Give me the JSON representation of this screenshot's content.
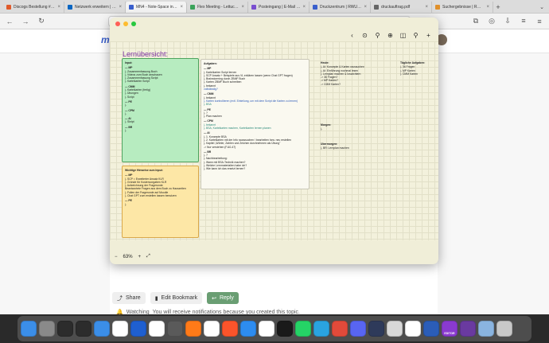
{
  "browser": {
    "tabs": [
      {
        "label": "Discogs Bestellung #76...",
        "color": "#e05a2b",
        "active": false
      },
      {
        "label": "Netzwerk erweitern | Li...",
        "color": "#0a66c2",
        "active": false
      },
      {
        "label": "MN4 - Note-Space in S...",
        "color": "#3a5fcd",
        "active": true
      },
      {
        "label": "Flex Meeting - Lettuce...",
        "color": "#3aa35a",
        "active": false
      },
      {
        "label": "Posteingang | E-Mail | ...",
        "color": "#7a4fd0",
        "active": false
      },
      {
        "label": "Druckzentrum | RWU H...",
        "color": "#3a5fcd",
        "active": false
      },
      {
        "label": "druckauftrag.pdf",
        "color": "#666666",
        "active": false
      },
      {
        "label": "Suchergebnisse | RWU...",
        "color": "#e0902b",
        "active": false
      }
    ],
    "new_tab": "+",
    "tab_overflow": "⌄",
    "nav": {
      "back": "←",
      "forward": "→",
      "reload": "↻",
      "shield": "◈",
      "lock": "🔒",
      "url": "",
      "star": "☆",
      "menu": "≡"
    },
    "extensions": [
      "⧉",
      "◎",
      "⇩",
      "≡"
    ]
  },
  "site": {
    "logo": "m",
    "close_tab": "×"
  },
  "note_app": {
    "toolbar_icons": [
      "‹",
      "⊙",
      "⚲",
      "⊕",
      "◫",
      "⚲",
      "+"
    ],
    "overview_title": "Lernübersicht:",
    "zoom": {
      "minus": "−",
      "value": "63%",
      "plus": "+",
      "fit": "⤢"
    },
    "cards": {
      "input": {
        "heading": "Input:",
        "sections": [
          {
            "title": "— MP",
            "items": [
              "  |- Zusammenfassung Buch",
              "  |- Videos zum Buch anschauen",
              "  |- Zusammenfassung Script",
              "  |- Karteikarten Script"
            ]
          },
          {
            "title": "— CMM",
            "items": [
              "  |- Karteikarten (fertig)",
              "  |- Übungen",
              "  |- Script"
            ]
          },
          {
            "title": "— PE",
            "items": [
              "  |-"
            ]
          },
          {
            "title": "— CPM",
            "items": [
              "  |-"
            ]
          },
          {
            "title": "— AI",
            "items": [
              "  |- Skript"
            ]
          },
          {
            "title": "— BR",
            "items": [
              "  |-"
            ]
          }
        ]
      },
      "hinweise": {
        "heading": "Wichtige Hinweise zum Input:",
        "sections": [
          {
            "title": "— MP",
            "items": [
              "  |- SCP = Erweiterter Ansatz KLR",
              "  |- Gründe für Kostenvorgaben KLR",
              "  |- Aufzeichnung der Fragerunde",
              "       Beantwortete Fragen aus dem Buch zu Hauszeiten",
              "  |- Folien der Fragerunde auf Moodle",
              "  |- Chat GPT zum erstellen lassen benutzen"
            ]
          },
          {
            "title": "— PE",
            "items": [
              "  |-"
            ]
          }
        ]
      },
      "aufgaben": {
        "heading": "Aufgaben:",
        "sections": [
          {
            "title": "— MP",
            "items": [
              "  |- Karteikarten Script lernen",
              "  |- SCP Ansatz + Beispiele aus VL erklären lassen (wenn Chat GPT fragen)",
              "  |- Brainstorming durch ZBMF Buch",
              "  |- Karten ZBMF Buch schreiben",
              "  |- bekannt"
            ],
            "notes": [
              "vollständig?"
            ]
          },
          {
            "title": "— CMM",
            "items": [
              "  |- bekannt",
              "  |- Karten kontrollieren (evtl. Einteilung, um mit dem Script die Karten zu lernen)",
              "  |- BSA"
            ]
          },
          {
            "title": "— PE",
            "items": [
              "  |- ?",
              "  |- Plan machen"
            ]
          },
          {
            "title": "— CPM",
            "items": [
              "  |- bekannt",
              "  |- BSA, Karteikarten machen, Karteikarten lernen planen"
            ]
          },
          {
            "title": "— AI",
            "items": [
              "  |- 1. Konzepte BSA",
              "  |- 2. Karteikarten mit der Info rausssuchen / bearbeiten bzw. neu erstellen",
              "  |- Kapitel „Wörter, Zahlen und Zeichen durchnehmen als Übung\"",
              "           -> Nur verstehen (F.A0-47)"
            ]
          },
          {
            "title": "— BR",
            "items": [
              "  |- ?",
              "  |- Nachbearbeitung:",
              "       |- Wann mit BSA-Technik machen?",
              "       |- Welche Lernmaterialien habe ich?",
              "       |- Wie kann ich das ersetzt lernen?"
            ]
          }
        ]
      },
      "heute": {
        "heading": "Heute:",
        "items": [
          "  |- AI: Konzepte & Karten raussuchen",
          "  |- AI: Einführung nochmal lesen",
          "  |- Lernplan machen & Ioswichtern",
          "        -> 36 Fragen?",
          "        -> MP Karten?",
          "        -> CMM Karten?"
        ]
      },
      "morgen": {
        "heading": "Morgen:",
        "items": [
          "  |-"
        ]
      },
      "uebermorgen": {
        "heading": "Übermorgen:",
        "items": [
          "  |- BR: Lernplan machen"
        ]
      },
      "taeglich": {
        "heading": "Tägliche Aufgaben:",
        "items": [
          "  |- 36 Fragen",
          "  |- MP Karten",
          "  |- CMM Karten"
        ]
      }
    }
  },
  "forum": {
    "share": "Share",
    "bookmark": "Edit Bookmark",
    "reply": "Reply",
    "watching": "Watching",
    "watching_msg": "You will receive notifications because you created this topic."
  },
  "dock": {
    "apps": [
      {
        "name": "finder",
        "color": "#3b8ee8"
      },
      {
        "name": "launchpad",
        "color": "#8a8a8a"
      },
      {
        "name": "activity",
        "color": "#2c2c2c"
      },
      {
        "name": "terminal",
        "color": "#2c2c2c"
      },
      {
        "name": "mail",
        "color": "#3b8ee8"
      },
      {
        "name": "notion",
        "color": "#ffffff"
      },
      {
        "name": "mn",
        "color": "#1f5fd0"
      },
      {
        "name": "calendar",
        "color": "#ffffff"
      },
      {
        "name": "app-gray",
        "color": "#5a5a5a"
      },
      {
        "name": "firefox",
        "color": "#ff7a18"
      },
      {
        "name": "photos",
        "color": "#ffffff"
      },
      {
        "name": "brave",
        "color": "#fb542b"
      },
      {
        "name": "safari",
        "color": "#2d8cf0"
      },
      {
        "name": "chrome",
        "color": "#ffffff"
      },
      {
        "name": "chatgpt",
        "color": "#1a1a1a"
      },
      {
        "name": "whatsapp",
        "color": "#25d366"
      },
      {
        "name": "telegram",
        "color": "#2aa3e0"
      },
      {
        "name": "app-red",
        "color": "#e24a3a"
      },
      {
        "name": "discord",
        "color": "#5865f2"
      },
      {
        "name": "university",
        "color": "#2e3a5a"
      },
      {
        "name": "app-pattern",
        "color": "#d8d8d8"
      },
      {
        "name": "chatgpt-2",
        "color": "#ffffff"
      },
      {
        "name": "word",
        "color": "#2b5db8"
      },
      {
        "name": "editor",
        "color": "#8a3ad0"
      },
      {
        "name": "folder",
        "color": "#6a3aa0"
      },
      {
        "name": "downloads",
        "color": "#8ab4e0"
      },
      {
        "name": "trash",
        "color": "#c8c8c8"
      }
    ],
    "editor_label": "EDITOR"
  }
}
